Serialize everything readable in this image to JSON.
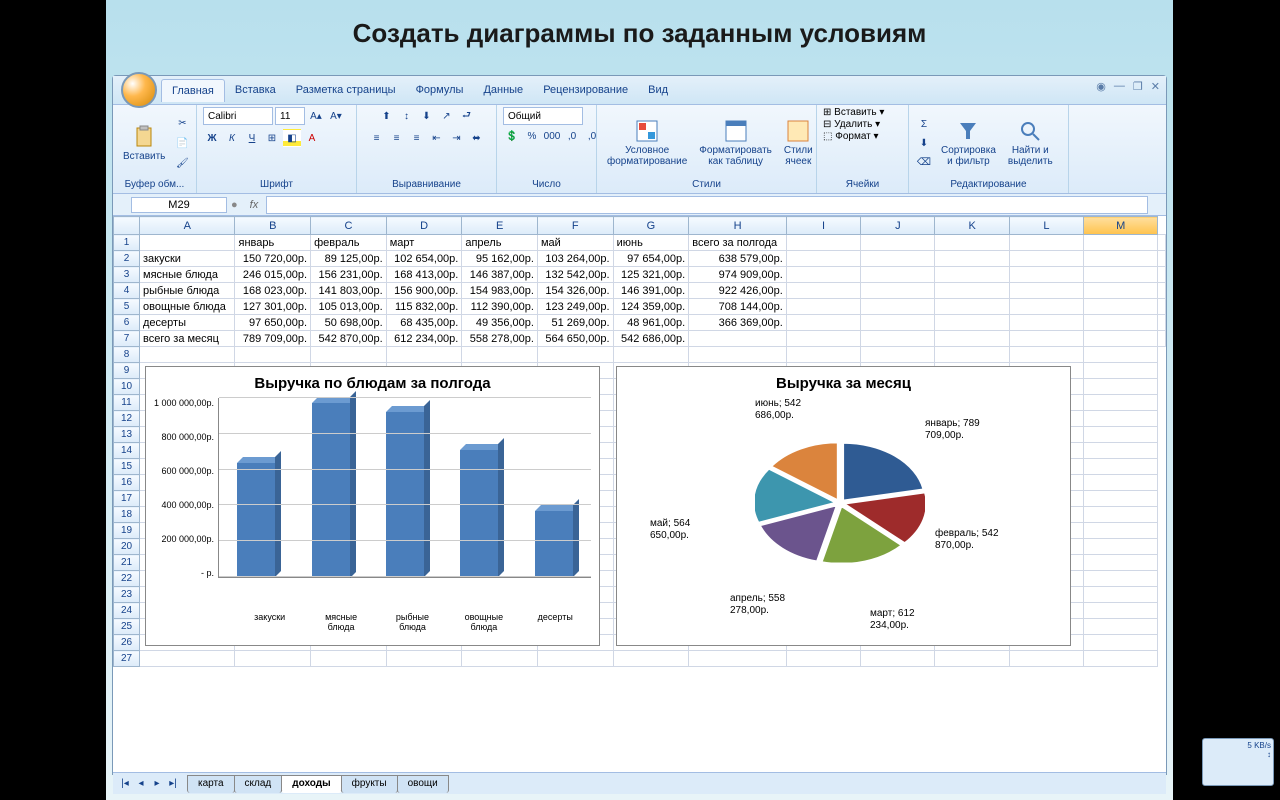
{
  "slide_title": "Создать диаграммы по заданным условиям",
  "ribbon_tabs": [
    "Главная",
    "Вставка",
    "Разметка страницы",
    "Формулы",
    "Данные",
    "Рецензирование",
    "Вид"
  ],
  "active_tab_idx": 0,
  "groups": {
    "clipboard": {
      "label": "Буфер обм...",
      "paste": "Вставить"
    },
    "font": {
      "label": "Шрифт",
      "name": "Calibri",
      "size": "11"
    },
    "align": {
      "label": "Выравнивание"
    },
    "number": {
      "label": "Число",
      "format": "Общий"
    },
    "styles": {
      "label": "Стили",
      "cond": "Условное\nформатирование",
      "table": "Форматировать\nкак таблицу",
      "cell": "Стили\nячеек"
    },
    "cells": {
      "label": "Ячейки",
      "insert": "Вставить",
      "delete": "Удалить",
      "format": "Формат"
    },
    "edit": {
      "label": "Редактирование",
      "sort": "Сортировка\nи фильтр",
      "find": "Найти и\nвыделить"
    }
  },
  "namebox": "M29",
  "columns": [
    "",
    "A",
    "B",
    "C",
    "D",
    "E",
    "F",
    "G",
    "H",
    "I",
    "J",
    "K",
    "L",
    "M"
  ],
  "col_headers": [
    "",
    "январь",
    "февраль",
    "март",
    "апрель",
    "май",
    "июнь",
    "всего за полгода"
  ],
  "rows": [
    {
      "label": "закуски",
      "v": [
        "150 720,00р.",
        "89 125,00р.",
        "102 654,00р.",
        "95 162,00р.",
        "103 264,00р.",
        "97 654,00р.",
        "638 579,00р."
      ]
    },
    {
      "label": "мясные блюда",
      "v": [
        "246 015,00р.",
        "156 231,00р.",
        "168 413,00р.",
        "146 387,00р.",
        "132 542,00р.",
        "125 321,00р.",
        "974 909,00р."
      ]
    },
    {
      "label": "рыбные блюда",
      "v": [
        "168 023,00р.",
        "141 803,00р.",
        "156 900,00р.",
        "154 983,00р.",
        "154 326,00р.",
        "146 391,00р.",
        "922 426,00р."
      ]
    },
    {
      "label": "овощные блюда",
      "v": [
        "127 301,00р.",
        "105 013,00р.",
        "115 832,00р.",
        "112 390,00р.",
        "123 249,00р.",
        "124 359,00р.",
        "708 144,00р."
      ]
    },
    {
      "label": "десерты",
      "v": [
        "97 650,00р.",
        "50 698,00р.",
        "68 435,00р.",
        "49 356,00р.",
        "51 269,00р.",
        "48 961,00р.",
        "366 369,00р."
      ]
    },
    {
      "label": "всего за месяц",
      "v": [
        "789 709,00р.",
        "542 870,00р.",
        "612 234,00р.",
        "558 278,00р.",
        "564 650,00р.",
        "542 686,00р.",
        ""
      ]
    }
  ],
  "chart_data": [
    {
      "type": "bar",
      "title": "Выручка по блюдам за полгода",
      "categories": [
        "закуски",
        "мясные\nблюда",
        "рыбные\nблюда",
        "овощные\nблюда",
        "десерты"
      ],
      "values": [
        638579,
        974909,
        922426,
        708144,
        366369
      ],
      "y_ticks": [
        "1 000 000,00р.",
        "800 000,00р.",
        "600 000,00р.",
        "400 000,00р.",
        "200 000,00р.",
        "- р."
      ],
      "ylim": [
        0,
        1000000
      ]
    },
    {
      "type": "pie",
      "title": "Выручка за месяц",
      "labels": [
        {
          "text": "январь; 789\n709,00р.",
          "x": 300,
          "y": 20
        },
        {
          "text": "февраль; 542\n870,00р.",
          "x": 310,
          "y": 130
        },
        {
          "text": "март; 612\n234,00р.",
          "x": 245,
          "y": 210
        },
        {
          "text": "апрель; 558\n278,00р.",
          "x": 105,
          "y": 195
        },
        {
          "text": "май; 564\n650,00р.",
          "x": 25,
          "y": 120
        },
        {
          "text": "июнь; 542\n686,00р.",
          "x": 130,
          "y": 0
        }
      ],
      "slices": [
        {
          "name": "январь",
          "value": 789709,
          "color": "#2f5b93"
        },
        {
          "name": "февраль",
          "value": 542870,
          "color": "#9e2b2b"
        },
        {
          "name": "март",
          "value": 612234,
          "color": "#7da23e"
        },
        {
          "name": "апрель",
          "value": 558278,
          "color": "#6b548d"
        },
        {
          "name": "май",
          "value": 564650,
          "color": "#3d96ae"
        },
        {
          "name": "июнь",
          "value": 542686,
          "color": "#db843d"
        }
      ]
    }
  ],
  "sheets": [
    "карта",
    "склад",
    "доходы",
    "фрукты",
    "овощи"
  ],
  "active_sheet_idx": 2,
  "netmon": "5 KB/s"
}
